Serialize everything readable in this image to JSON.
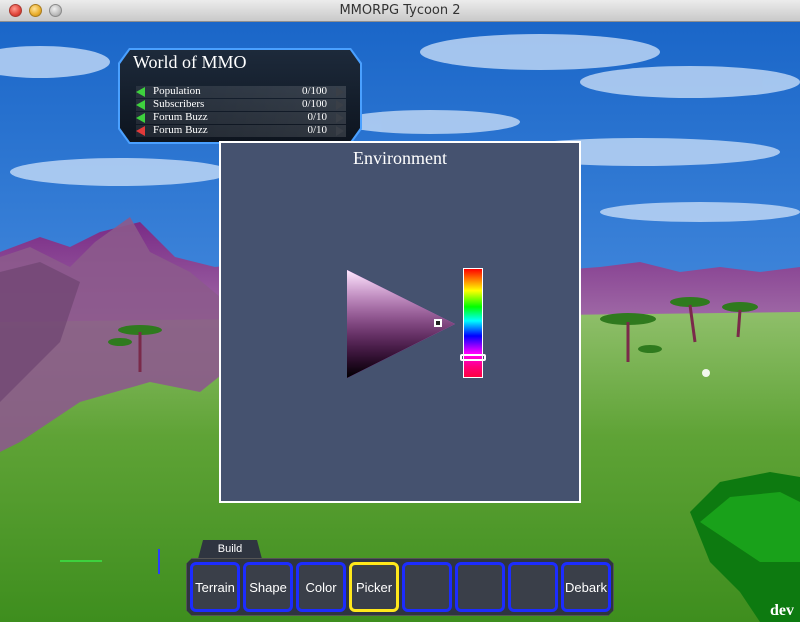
{
  "window": {
    "title": "MMORPG Tycoon 2"
  },
  "world_panel": {
    "title": "World of MMO",
    "stats": [
      {
        "label": "Population",
        "value": "0/100",
        "trend": "up"
      },
      {
        "label": "Subscribers",
        "value": "0/100",
        "trend": "up"
      },
      {
        "label": "Forum Buzz",
        "value": "0/10",
        "trend": "up"
      },
      {
        "label": "Forum Buzz",
        "value": "0/10",
        "trend": "down"
      }
    ]
  },
  "environment_dialog": {
    "title": "Environment",
    "selected_hue_color": "#ff33ff",
    "hue_position_fraction": 0.82
  },
  "toolbar": {
    "tab_label": "Build",
    "buttons": [
      {
        "label": "Terrain",
        "active": false
      },
      {
        "label": "Shape",
        "active": false
      },
      {
        "label": "Color",
        "active": false
      },
      {
        "label": "Picker",
        "active": true
      },
      {
        "label": "",
        "active": false
      },
      {
        "label": "",
        "active": false
      },
      {
        "label": "",
        "active": false
      },
      {
        "label": "Debark",
        "active": false
      }
    ]
  },
  "build_mode_label": "dev",
  "colors": {
    "panel_glow": "#4aa0ff",
    "button_border": "#1c2cff",
    "button_active_border": "#ffe81c",
    "trend_up": "#3ed13e",
    "trend_down": "#e23a3a"
  }
}
